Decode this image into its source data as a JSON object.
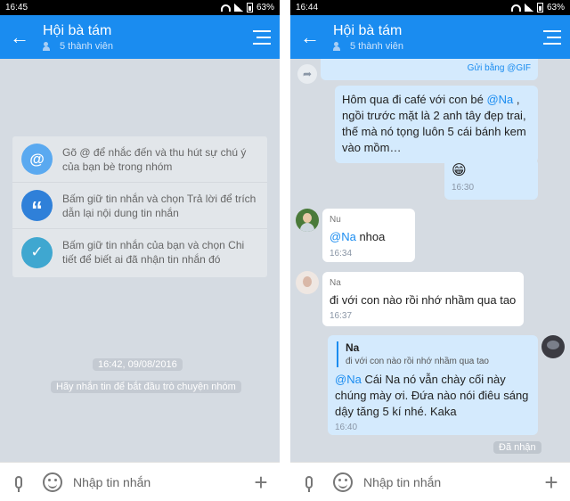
{
  "left": {
    "status": {
      "time": "16:45",
      "battery": "63%"
    },
    "header": {
      "title": "Hội bà tám",
      "subtitle": "5 thành viên"
    },
    "tips": [
      {
        "icon": "at-icon",
        "icon_glyph": "@",
        "color": "#5aa9f0",
        "text": "Gõ @ để nhắc đến và thu hút sự chú ý của bạn bè trong nhóm"
      },
      {
        "icon": "quote-icon",
        "icon_glyph": "“",
        "color": "#2f80d9",
        "text": "Bấm giữ tin nhắn và chọn Trả lời để trích dẫn lại nội dung tin nhắn"
      },
      {
        "icon": "check-icon",
        "icon_glyph": "✓",
        "color": "#3fa7d0",
        "text": "Bấm giữ tin nhắn của bạn và chọn Chi tiết để biết ai đã nhận tin nhắn đó"
      }
    ],
    "date_pill": "16:42, 09/08/2016",
    "start_hint": "Hãy nhắn tin để bắt đầu trò chuyện nhóm",
    "input_placeholder": "Nhập tin nhắn"
  },
  "right": {
    "status": {
      "time": "16:44",
      "battery": "63%"
    },
    "header": {
      "title": "Hội bà tám",
      "subtitle": "5 thành viên"
    },
    "gif_label": "Gửi bằng @GIF",
    "messages": [
      {
        "id": "m1",
        "mine": true,
        "mention": "@Na",
        "text_before": "Hôm qua đi café với con bé ",
        "text_after": " , ngồi trước mặt là 2 anh tây đẹp trai, thế mà nó tọng luôn 5 cái bánh kem vào mồm…"
      },
      {
        "id": "m2",
        "mine": true,
        "emoji": "😁",
        "time": "16:30"
      },
      {
        "id": "m3",
        "mine": false,
        "sender": "Nu",
        "mention": "@Na",
        "text": " nhoa",
        "time": "16:34"
      },
      {
        "id": "m4",
        "mine": false,
        "sender": "Na",
        "text": "đi với con nào rồi nhớ nhầm qua tao",
        "time": "16:37"
      },
      {
        "id": "m5",
        "mine": true,
        "quote_sender": "Na",
        "quote_text": "đi với con nào rồi nhớ nhầm qua tao",
        "mention": "@Na",
        "text": " Cái Na nó vẫn chày cối này chúng mày ơi. Đứa nào nói điêu sáng dậy tăng 5 kí nhé. Kaka",
        "time": "16:40"
      }
    ],
    "delivered": "Đã nhận",
    "input_placeholder": "Nhập tin nhắn"
  }
}
